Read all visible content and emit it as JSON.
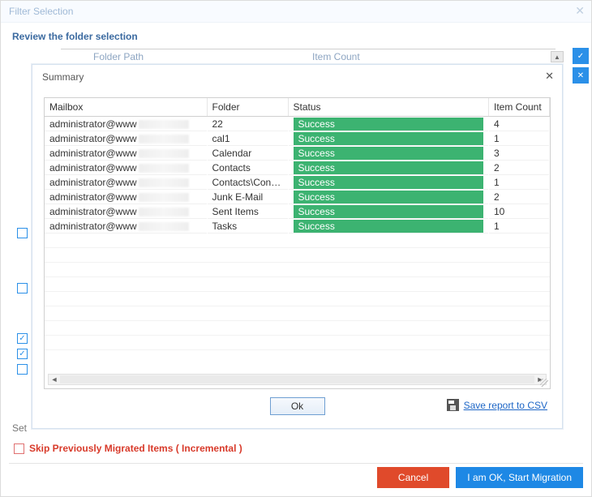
{
  "outer": {
    "title": "Filter Selection",
    "subtitle": "Review the folder selection",
    "bg_cols": {
      "folder_path": "Folder Path",
      "item_count": "Item Count"
    },
    "set_label": "Set",
    "skip_label": "Skip Previously Migrated Items ( Incremental )",
    "cancel": "Cancel",
    "start": "I am OK, Start Migration"
  },
  "modal": {
    "title": "Summary",
    "ok": "Ok",
    "save": "Save report to CSV",
    "cols": {
      "mailbox": "Mailbox",
      "folder": "Folder",
      "status": "Status",
      "item_count": "Item Count"
    },
    "rows": [
      {
        "mailbox": "administrator@www",
        "folder": "22",
        "status": "Success",
        "count": "4"
      },
      {
        "mailbox": "administrator@www",
        "folder": "cal1",
        "status": "Success",
        "count": "1"
      },
      {
        "mailbox": "administrator@www",
        "folder": "Calendar",
        "status": "Success",
        "count": "3"
      },
      {
        "mailbox": "administrator@www",
        "folder": "Contacts",
        "status": "Success",
        "count": "2"
      },
      {
        "mailbox": "administrator@www",
        "folder": "Contacts\\Conta...",
        "status": "Success",
        "count": "1"
      },
      {
        "mailbox": "administrator@www",
        "folder": "Junk E-Mail",
        "status": "Success",
        "count": "2"
      },
      {
        "mailbox": "administrator@www",
        "folder": "Sent Items",
        "status": "Success",
        "count": "10"
      },
      {
        "mailbox": "administrator@www",
        "folder": "Tasks",
        "status": "Success",
        "count": "1"
      }
    ]
  },
  "bg_checks": [
    false,
    false,
    true,
    true,
    false
  ]
}
